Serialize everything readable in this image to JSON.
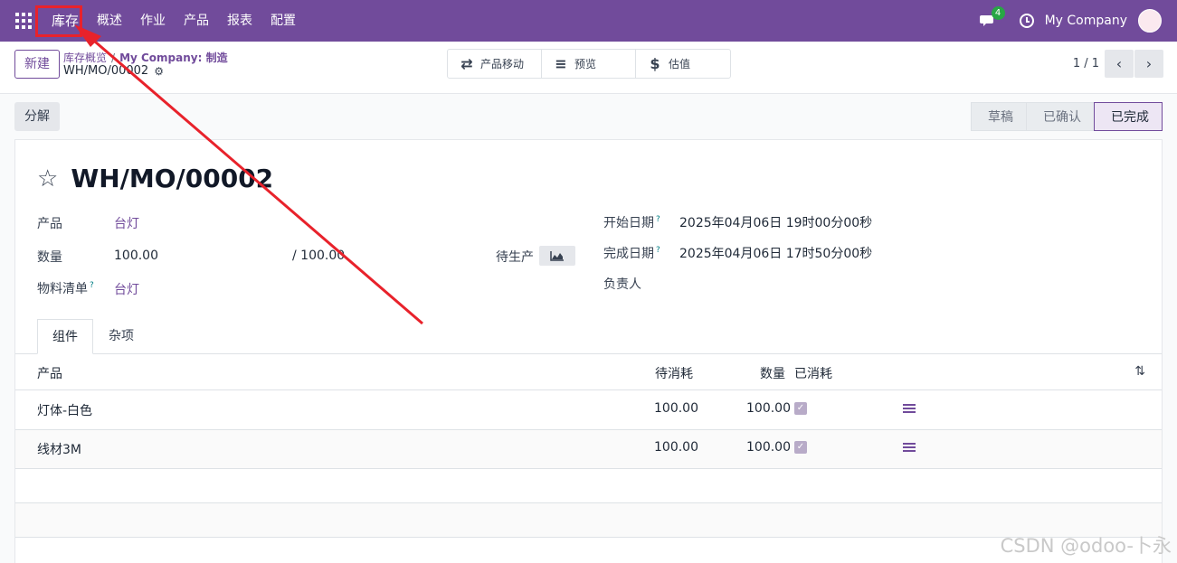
{
  "navbar": {
    "menu": [
      "库存",
      "概述",
      "作业",
      "产品",
      "报表",
      "配置"
    ],
    "message_count": "4",
    "company": "My Company"
  },
  "control_panel": {
    "new_label": "新建",
    "breadcrumb": [
      "库存概览",
      "My Company: 制造"
    ],
    "record_name": "WH/MO/00002",
    "stat_buttons": [
      "产品移动",
      "预览",
      "估值"
    ],
    "pager": "1 / 1"
  },
  "actions": {
    "unbuild_label": "分解",
    "statuses": [
      "草稿",
      "已确认",
      "已完成"
    ],
    "active_status": "已完成"
  },
  "form": {
    "title": "WH/MO/00002",
    "product_label": "产品",
    "product_value": "台灯",
    "quantity_label": "数量",
    "quantity_value": "100.00",
    "quantity_total": "/ 100.00",
    "bom_label": "物料清单",
    "bom_value": "台灯",
    "pending_label": "待生产",
    "start_label": "开始日期",
    "start_value": "2025年04月06日 19时00分00秒",
    "end_label": "完成日期",
    "end_value": "2025年04月06日 17时50分00秒",
    "responsible_label": "负责人",
    "help_mark": "?"
  },
  "tabs": [
    "组件",
    "杂项"
  ],
  "table": {
    "headers": [
      "产品",
      "待消耗",
      "数量",
      "已消耗"
    ],
    "rows": [
      {
        "product": "灯体-白色",
        "to_consume": "100.00",
        "quantity": "100.00"
      },
      {
        "product": "线材3M",
        "to_consume": "100.00",
        "quantity": "100.00"
      }
    ]
  },
  "watermark": "CSDN @odoo-卜永",
  "colors": {
    "brand": "#714b9b",
    "annotation": "#e8222b"
  }
}
